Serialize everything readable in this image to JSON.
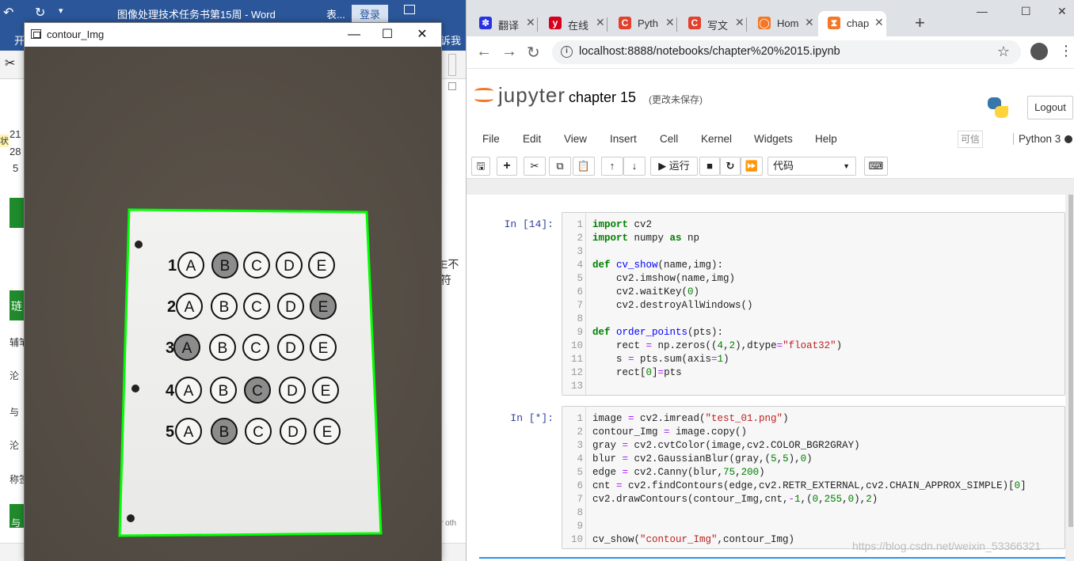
{
  "word": {
    "doc_title": "图像处理技术任务书第15周  -  Word",
    "table_tool": "表...",
    "login": "登录",
    "tab_start": "开",
    "tab_tell": "诉我",
    "side_text_1": "21",
    "side_text_2": "28",
    "side_text_3": "5",
    "side_text_4": "状",
    "side_text_5": "琏",
    "side_text_6": "辅笔",
    "side_text_7": "沦",
    "side_text_8": "与",
    "side_text_9": "沦",
    "side_text_10": "称签",
    "side_text_11": "与",
    "side_text_right": "E不符",
    "side_text_bottom": "r oth"
  },
  "cv_window": {
    "title": "contour_Img",
    "minimize": "—",
    "maximize": "☐",
    "close": "✕",
    "sheet": {
      "rows": [
        {
          "num": "1",
          "options": [
            "A",
            "B",
            "C",
            "D",
            "E"
          ],
          "filled": 1
        },
        {
          "num": "2",
          "options": [
            "A",
            "B",
            "C",
            "D",
            "E"
          ],
          "filled": 4
        },
        {
          "num": "3",
          "options": [
            "A",
            "B",
            "C",
            "D",
            "E"
          ],
          "filled": 0
        },
        {
          "num": "4",
          "options": [
            "A",
            "B",
            "C",
            "D",
            "E"
          ],
          "filled": 2
        },
        {
          "num": "5",
          "options": [
            "A",
            "B",
            "C",
            "D",
            "E"
          ],
          "filled": 1
        }
      ],
      "contour_color": "#00ff00"
    }
  },
  "chrome": {
    "tabs": [
      {
        "label": "翻译",
        "fav_color": "#2932e1",
        "fav_glyph": "✽"
      },
      {
        "label": "在线",
        "fav_color": "#d6001c",
        "fav_glyph": "y"
      },
      {
        "label": "Pyth",
        "fav_color": "#e2402c",
        "fav_glyph": "C"
      },
      {
        "label": "写文",
        "fav_color": "#e2402c",
        "fav_glyph": "C"
      },
      {
        "label": "Hom",
        "fav_color": "#f37726",
        "fav_glyph": "◯"
      },
      {
        "label": "chap",
        "fav_color": "#f37726",
        "fav_glyph": "⧗"
      }
    ],
    "new_tab": "+",
    "url": "localhost:8888/notebooks/chapter%20%2015.ipynb",
    "controls": {
      "min": "—",
      "max": "☐",
      "close": "✕"
    }
  },
  "jupyter": {
    "brand": "jupyter",
    "notebook_name": "chapter 15",
    "autosave": "(更改未保存)",
    "logout": "Logout",
    "menu": [
      "File",
      "Edit",
      "View",
      "Insert",
      "Cell",
      "Kernel",
      "Widgets",
      "Help"
    ],
    "trusted": "可信",
    "kernel": "Python 3",
    "toolbar": {
      "run": "▶ 运行",
      "cell_type": "代码"
    },
    "cells": [
      {
        "prompt": "In  [14]:",
        "lines": [
          {
            "n": "1",
            "html": "<span class=\"kw\">import</span> cv2"
          },
          {
            "n": "2",
            "html": "<span class=\"kw\">import</span> numpy <span class=\"kw\">as</span> np"
          },
          {
            "n": "3",
            "html": ""
          },
          {
            "n": "4",
            "html": "<span class=\"kw\">def</span> <span class=\"fn\">cv_show</span>(name,img):"
          },
          {
            "n": "5",
            "html": "    cv2.imshow(name,img)"
          },
          {
            "n": "6",
            "html": "    cv2.waitKey(<span class=\"nm\">0</span>)"
          },
          {
            "n": "7",
            "html": "    cv2.destroyAllWindows()"
          },
          {
            "n": "8",
            "html": ""
          },
          {
            "n": "9",
            "html": "<span class=\"kw\">def</span> <span class=\"fn\">order_points</span>(pts):"
          },
          {
            "n": "10",
            "html": "    rect <span class=\"op\">=</span> np.zeros((<span class=\"nm\">4</span>,<span class=\"nm\">2</span>),dtype<span class=\"op\">=</span><span class=\"st\">\"float32\"</span>)"
          },
          {
            "n": "11",
            "html": "    s <span class=\"op\">=</span> pts.sum(axis<span class=\"op\">=</span><span class=\"nm\">1</span>)"
          },
          {
            "n": "12",
            "html": "    rect[<span class=\"nm\">0</span>]<span class=\"op\">=</span>pts"
          },
          {
            "n": "13",
            "html": ""
          }
        ]
      },
      {
        "prompt": "In  [*]:",
        "lines": [
          {
            "n": "1",
            "html": "image <span class=\"op\">=</span> cv2.imread(<span class=\"st\">\"test_01.png\"</span>)"
          },
          {
            "n": "2",
            "html": "contour_Img <span class=\"op\">=</span> image.copy()"
          },
          {
            "n": "3",
            "html": "gray <span class=\"op\">=</span> cv2.cvtColor(image,cv2.COLOR_BGR2GRAY)"
          },
          {
            "n": "4",
            "html": "blur <span class=\"op\">=</span> cv2.GaussianBlur(gray,(<span class=\"nm\">5</span>,<span class=\"nm\">5</span>),<span class=\"nm\">0</span>)"
          },
          {
            "n": "5",
            "html": "edge <span class=\"op\">=</span> cv2.Canny(blur,<span class=\"nm\">75</span>,<span class=\"nm\">200</span>)"
          },
          {
            "n": "6",
            "html": "cnt <span class=\"op\">=</span> cv2.findContours(edge,cv2.RETR_EXTERNAL,cv2.CHAIN_APPROX_SIMPLE)[<span class=\"nm\">0</span>]"
          },
          {
            "n": "7",
            "html": "cv2.drawContours(contour_Img,cnt,<span class=\"op\">-</span><span class=\"nm\">1</span>,(<span class=\"nm\">0</span>,<span class=\"nm\">255</span>,<span class=\"nm\">0</span>),<span class=\"nm\">2</span>)"
          },
          {
            "n": "8",
            "html": ""
          },
          {
            "n": "9",
            "html": ""
          },
          {
            "n": "10",
            "html": "cv_show(<span class=\"st\">\"contour_Img\"</span>,contour_Img)"
          }
        ]
      }
    ]
  },
  "watermark": "https://blog.csdn.net/weixin_53366321"
}
